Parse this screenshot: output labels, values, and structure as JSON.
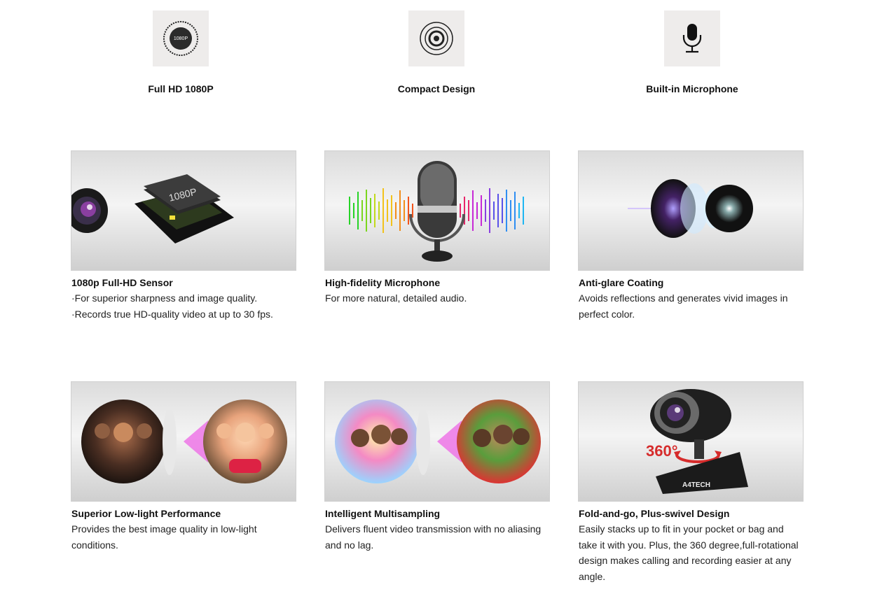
{
  "top_features": [
    {
      "label": "Full HD 1080P",
      "icon": "1080p-badge-icon",
      "badge_text": "1080P"
    },
    {
      "label": "Compact Design",
      "icon": "camera-lens-icon"
    },
    {
      "label": "Built-in Microphone",
      "icon": "microphone-icon"
    }
  ],
  "cards": [
    {
      "title": "1080p Full-HD Sensor",
      "lines": [
        "·For superior sharpness and image quality.",
        "·Records true HD-quality video at up to 30 fps."
      ],
      "image": "sensor-chip-image",
      "chip_text": "1080P"
    },
    {
      "title": "High-fidelity Microphone",
      "lines": [
        "For more natural, detailed audio."
      ],
      "image": "studio-microphone-image"
    },
    {
      "title": "Anti-glare Coating",
      "lines": [
        "Avoids reflections and generates vivid images in",
        "perfect color."
      ],
      "image": "lens-elements-image"
    },
    {
      "title": "Superior Low-light Performance",
      "lines": [
        "Provides the best image quality in low-light",
        "conditions."
      ],
      "image": "children-lowlight-image"
    },
    {
      "title": "Intelligent Multisampling",
      "lines": [
        "Delivers fluent video transmission with no aliasing",
        "and no lag."
      ],
      "image": "children-multisampling-image"
    },
    {
      "title": "Fold-and-go, Plus-swivel Design",
      "lines": [
        "Easily stacks up to fit in your pocket or bag and",
        "take it with you. Plus, the 360 degree,full-rotational",
        "design makes calling and recording easier at any",
        "angle."
      ],
      "image": "webcam-swivel-image",
      "rotation_text": "360°",
      "brand_text": "A4TECH"
    }
  ]
}
